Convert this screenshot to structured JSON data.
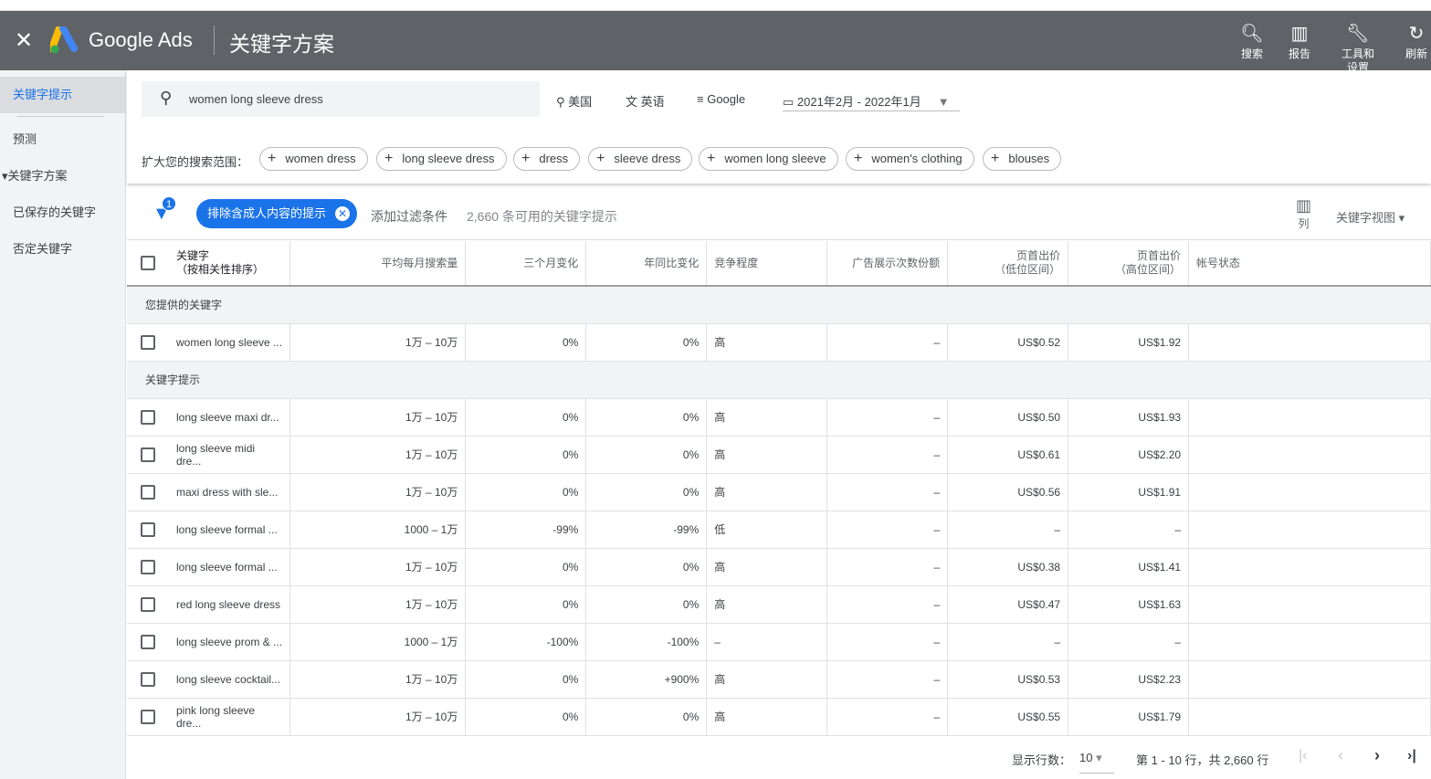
{
  "header": {
    "close": "✕",
    "brand": "Google Ads",
    "title": "关键字方案",
    "tools": [
      {
        "icon": "search-icon",
        "glyph": "🔍︎",
        "label": "搜索"
      },
      {
        "icon": "report-icon",
        "glyph": "▥",
        "label": "报告"
      },
      {
        "icon": "wrench-icon",
        "glyph": "🔧︎",
        "label": "工具和设置"
      },
      {
        "icon": "refresh-icon",
        "glyph": "↻",
        "label": "刷新"
      }
    ]
  },
  "sidebar": {
    "items": [
      {
        "label": "关键字提示"
      },
      {
        "label": "预测"
      },
      {
        "label": "▾关键字方案"
      },
      {
        "label": "已保存的关键字"
      },
      {
        "label": "否定关键字"
      }
    ]
  },
  "search": {
    "value": "women long sleeve dress",
    "location": "美国",
    "language": "英语",
    "network": "Google",
    "date_range": "2021年2月 - 2022年1月"
  },
  "expand": {
    "label": "扩大您的搜索范围：",
    "chips": [
      "women dress",
      "long sleeve dress",
      "dress",
      "sleeve dress",
      "women long sleeve",
      "women's clothing",
      "blouses"
    ]
  },
  "filters": {
    "badge": "1",
    "active_filter": "排除含成人内容的提示",
    "add_filter": "添加过滤条件",
    "count": "2,660 条可用的关键字提示",
    "columns": "列",
    "view": "关键字视图"
  },
  "table": {
    "headers": [
      "关键字\n（按相关性排序）",
      "平均每月搜索量",
      "三个月变化",
      "年同比变化",
      "竞争程度",
      "广告展示次数份额",
      "页首出价\n（低位区间）",
      "页首出价\n（高位区间）",
      "帐号状态"
    ],
    "group1": "您提供的关键字",
    "provided": [
      [
        "women long sleeve ...",
        "1万 – 10万",
        "0%",
        "0%",
        "高",
        "–",
        "US$0.52",
        "US$1.92",
        ""
      ]
    ],
    "group2": "关键字提示",
    "rows": [
      [
        "long sleeve maxi dr...",
        "1万 – 10万",
        "0%",
        "0%",
        "高",
        "–",
        "US$0.50",
        "US$1.93",
        ""
      ],
      [
        "long sleeve midi dre...",
        "1万 – 10万",
        "0%",
        "0%",
        "高",
        "–",
        "US$0.61",
        "US$2.20",
        ""
      ],
      [
        "maxi dress with sle...",
        "1万 – 10万",
        "0%",
        "0%",
        "高",
        "–",
        "US$0.56",
        "US$1.91",
        ""
      ],
      [
        "long sleeve formal ...",
        "1000 – 1万",
        "-99%",
        "-99%",
        "低",
        "–",
        "–",
        "–",
        ""
      ],
      [
        "long sleeve formal ...",
        "1万 – 10万",
        "0%",
        "0%",
        "高",
        "–",
        "US$0.38",
        "US$1.41",
        ""
      ],
      [
        "red long sleeve dress",
        "1万 – 10万",
        "0%",
        "0%",
        "高",
        "–",
        "US$0.47",
        "US$1.63",
        ""
      ],
      [
        "long sleeve prom & ...",
        "1000 – 1万",
        "-100%",
        "-100%",
        "–",
        "–",
        "–",
        "–",
        ""
      ],
      [
        "long sleeve cocktail...",
        "1万 – 10万",
        "0%",
        "+900%",
        "高",
        "–",
        "US$0.53",
        "US$2.23",
        ""
      ],
      [
        "pink long sleeve dre...",
        "1万 – 10万",
        "0%",
        "0%",
        "高",
        "–",
        "US$0.55",
        "US$1.79",
        ""
      ]
    ]
  },
  "pagination": {
    "rows_label": "显示行数：",
    "rows_value": "10",
    "range": "第 1 - 10 行，共 2,660 行"
  },
  "colors": {
    "header": "#5f6368",
    "accent": "#1a73e8"
  }
}
